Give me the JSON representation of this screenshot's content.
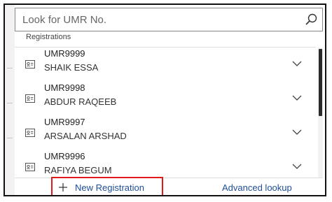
{
  "search": {
    "placeholder": "Look for UMR No.",
    "value": ""
  },
  "list_header": "Registrations",
  "records": [
    {
      "id": "UMR9999",
      "name": "SHAIK ESSA",
      "icon": "record-card-icon"
    },
    {
      "id": "UMR9998",
      "name": "ABDUR RAQEEB",
      "icon": "record-card-icon"
    },
    {
      "id": "UMR9997",
      "name": "ARSALAN ARSHAD",
      "icon": "record-card-icon"
    },
    {
      "id": "UMR9996",
      "name": "RAFIYA BEGUM",
      "icon": "record-card-icon"
    }
  ],
  "footer": {
    "new_label": "New Registration",
    "advanced_label": "Advanced lookup"
  },
  "colors": {
    "highlight_border": "#e11b1b",
    "link": "#1f4e99"
  }
}
